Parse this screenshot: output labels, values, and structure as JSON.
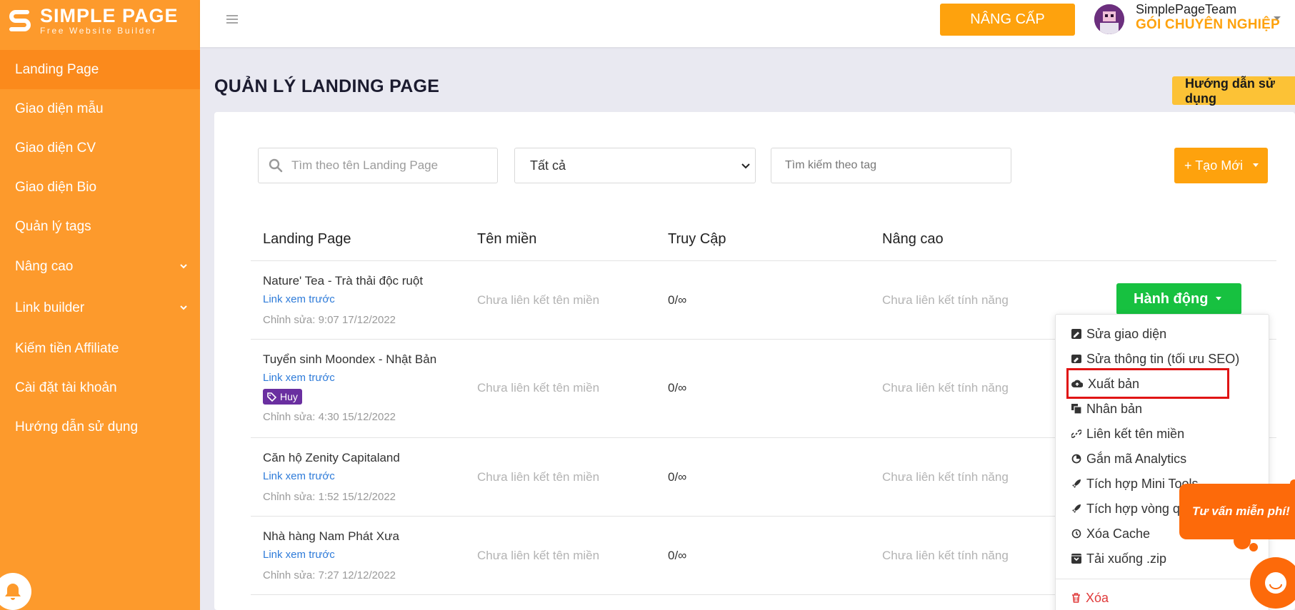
{
  "brand": {
    "name": "SIMPLE PAGE",
    "tagline": "Free Website Builder"
  },
  "sidebar": {
    "items": [
      {
        "label": "Landing Page",
        "active": true
      },
      {
        "label": "Giao diện mẫu"
      },
      {
        "label": "Giao diện CV"
      },
      {
        "label": "Giao diện Bio"
      },
      {
        "label": "Quản lý tags"
      },
      {
        "label": "Nâng cao",
        "expandable": true
      },
      {
        "label": "Link builder",
        "expandable": true
      },
      {
        "label": "Kiếm tiền Affiliate"
      },
      {
        "label": "Cài đặt tài khoản"
      },
      {
        "label": "Hướng dẫn sử dụng"
      }
    ]
  },
  "header": {
    "upgrade_label": "NÂNG CẤP",
    "user_name": "SimplePageTeam",
    "user_plan": "GÓI CHUYÊN NGHIỆP"
  },
  "page": {
    "title": "QUẢN LÝ LANDING PAGE",
    "guide_label": "Hướng dẫn sử dụng"
  },
  "filters": {
    "search_placeholder": "Tìm theo tên Landing Page",
    "status_selected": "Tất cả",
    "tag_placeholder": "Tìm kiếm theo tag",
    "create_label": "+ Tạo Mới"
  },
  "table": {
    "headers": [
      "Landing Page",
      "Tên miền",
      "Truy Cập",
      "Nâng cao"
    ],
    "rows": [
      {
        "name": "Nature' Tea - Trà thải độc ruột",
        "link": "Link xem trước",
        "edited": "Chỉnh sửa: 9:07 17/12/2022",
        "domain": "Chưa liên kết tên miền",
        "access": "0/∞",
        "feature": "Chưa liên kết tính năng"
      },
      {
        "name": "Tuyển sinh Moondex - Nhật Bản",
        "link": "Link xem trước",
        "tag": "Huy",
        "edited": "Chỉnh sửa: 4:30 15/12/2022",
        "domain": "Chưa liên kết tên miền",
        "access": "0/∞",
        "feature": "Chưa liên kết tính năng"
      },
      {
        "name": "Căn hộ Zenity Capitaland",
        "link": "Link xem trước",
        "edited": "Chỉnh sửa: 1:52 15/12/2022",
        "domain": "Chưa liên kết tên miền",
        "access": "0/∞",
        "feature": "Chưa liên kết tính năng"
      },
      {
        "name": "Nhà hàng Nam Phát Xưa",
        "link": "Link xem trước",
        "edited": "Chỉnh sửa: 7:27 12/12/2022",
        "domain": "Chưa liên kết tên miền",
        "access": "0/∞",
        "feature": "Chưa liên kết tính năng"
      }
    ],
    "action_label": "Hành động"
  },
  "action_menu": {
    "items": [
      {
        "label": "Sửa giao diện",
        "icon": "edit-layout-icon"
      },
      {
        "label": "Sửa thông tin (tối ưu SEO)",
        "icon": "seo-icon"
      },
      {
        "label": "Xuất bản",
        "icon": "cloud-upload-icon",
        "highlighted": true
      },
      {
        "label": "Nhân bản",
        "icon": "copy-icon"
      },
      {
        "label": "Liên kết tên miền",
        "icon": "link-icon"
      },
      {
        "label": "Gắn mã Analytics",
        "icon": "chart-pie-icon"
      },
      {
        "label": "Tích hợp Mini Tools",
        "icon": "rocket-icon"
      },
      {
        "label": "Tích hợp vòng quay",
        "icon": "rocket-icon"
      },
      {
        "label": "Xóa Cache",
        "icon": "history-icon"
      },
      {
        "label": "Tải xuống .zip",
        "icon": "archive-icon"
      },
      {
        "label": "Xóa",
        "icon": "trash-icon",
        "danger": true
      }
    ]
  },
  "floating": {
    "consult_label": "Tư vấn miễn phí!"
  },
  "colors": {
    "sidebar": "#fd9a2c",
    "accent": "#fea20d",
    "success": "#17c140",
    "highlight": "#e01414",
    "link": "#2e7bd9"
  }
}
